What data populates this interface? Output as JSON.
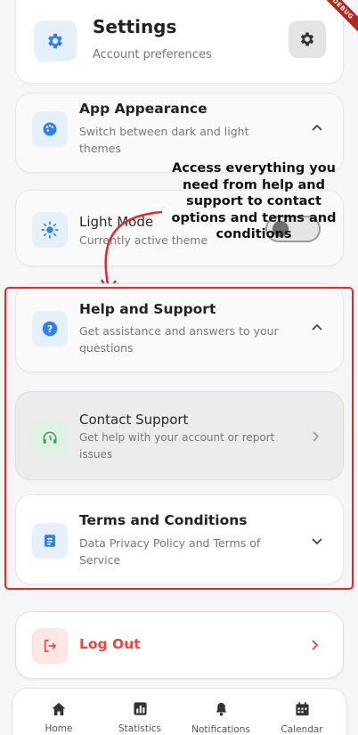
{
  "header": {
    "title": "Settings",
    "subtitle": "Account preferences",
    "debug_banner": "DEBUG"
  },
  "annotation": "Access everything you need from help and support to contact options and terms and conditions",
  "sections": {
    "app_appearance": {
      "title": "App Appearance",
      "subtitle": "Switch between dark and light themes"
    },
    "light_mode": {
      "title": "Light Mode",
      "subtitle": "Currently active theme"
    },
    "help_support": {
      "title": "Help and Support",
      "subtitle": "Get assistance and answers to your questions"
    },
    "contact_support": {
      "title": "Contact Support",
      "subtitle": "Get help with your account or report issues"
    },
    "terms": {
      "title": "Terms and Conditions",
      "subtitle": "Data Privacy Policy and Terms of Service"
    },
    "logout": {
      "label": "Log Out"
    }
  },
  "nav": [
    {
      "label": "Home",
      "icon": "home-icon"
    },
    {
      "label": "Statistics",
      "icon": "statistics-icon"
    },
    {
      "label": "Notifications",
      "icon": "bell-icon"
    },
    {
      "label": "Calendar",
      "icon": "calendar-icon"
    }
  ],
  "colors": {
    "accent_blue": "#2f80ed",
    "icon_bg_blue": "#e6f0fb",
    "logout_red": "#e5483f",
    "highlight_red": "#e8262b",
    "green": "#3fa55b"
  }
}
